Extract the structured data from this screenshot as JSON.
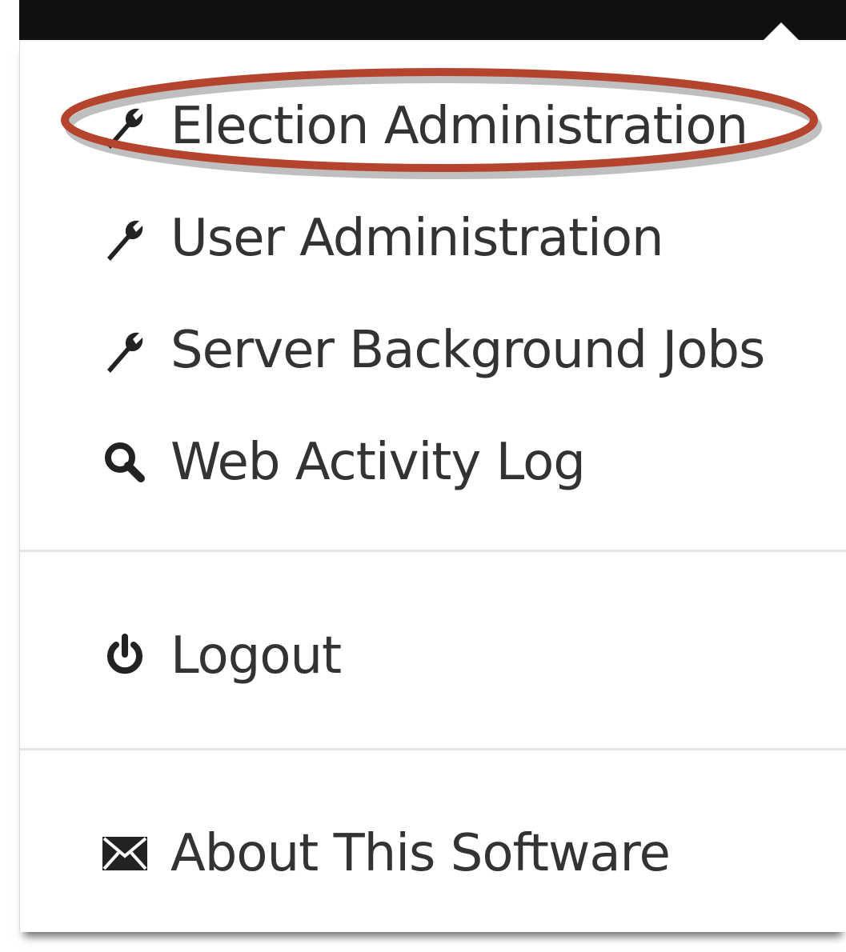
{
  "menu": {
    "items": [
      {
        "label": "Election Administration",
        "icon": "wrench-icon"
      },
      {
        "label": "User Administration",
        "icon": "wrench-icon"
      },
      {
        "label": "Server Background Jobs",
        "icon": "wrench-icon"
      },
      {
        "label": "Web Activity Log",
        "icon": "search-icon"
      },
      {
        "label": "Logout",
        "icon": "power-icon"
      },
      {
        "label": "About This Software",
        "icon": "envelope-icon"
      }
    ]
  },
  "colors": {
    "highlight_ellipse": "#b5442f",
    "topbar": "#111111",
    "text": "#333333",
    "divider": "#e5e5e5"
  }
}
